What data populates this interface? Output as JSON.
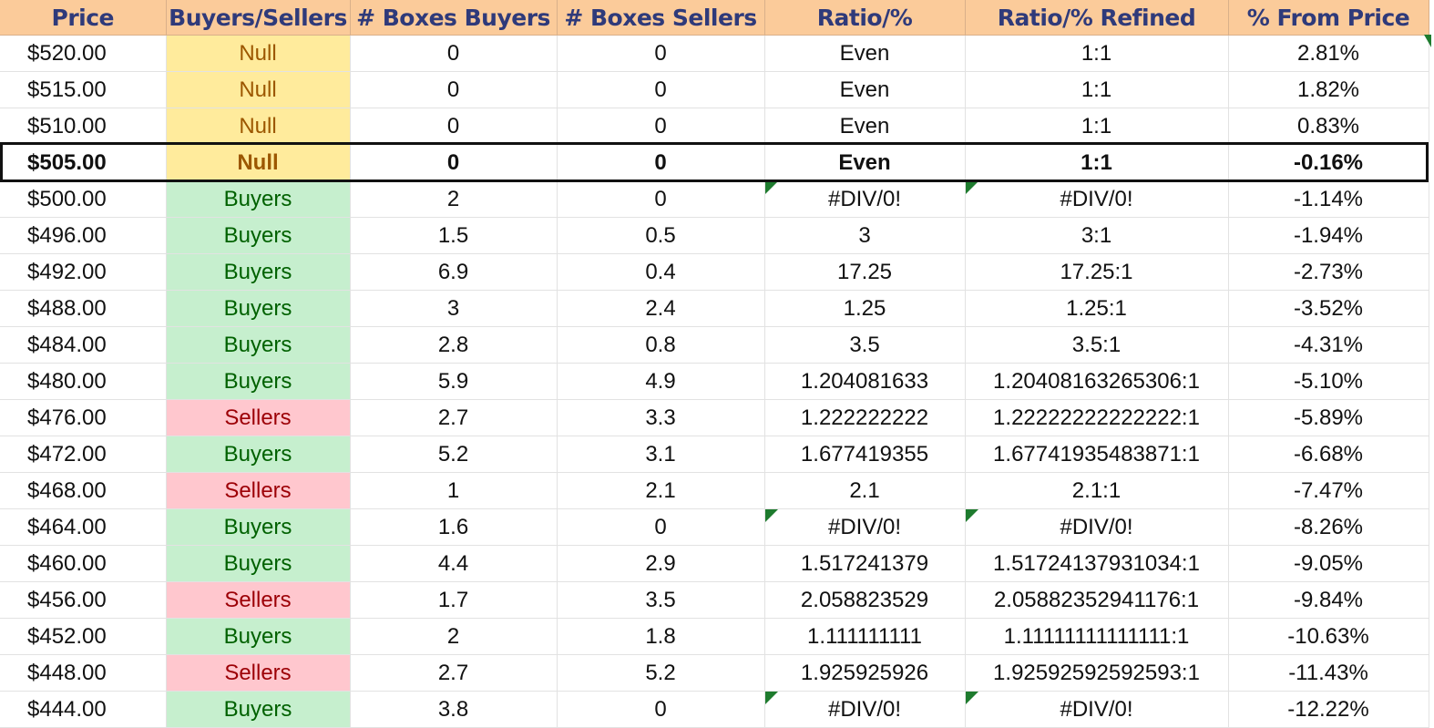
{
  "headers": [
    "Price",
    "Buyers/Sellers",
    "# Boxes Buyers",
    "# Boxes Sellers",
    "Ratio/%",
    "Ratio/% Refined",
    "% From Price"
  ],
  "colors": {
    "header_bg": "#fbcb9a",
    "header_text": "#2f3a7a",
    "null_bg": "#ffeb9c",
    "null_text": "#9c5700",
    "buyers_bg": "#c6efce",
    "buyers_text": "#006100",
    "sellers_bg": "#ffc7ce",
    "sellers_text": "#9c0006",
    "error_flag": "#1e7b2e"
  },
  "rows": [
    {
      "price": "$520.00",
      "side": "Null",
      "boxes_buyers": "0",
      "boxes_sellers": "0",
      "ratio": "Even",
      "ratio_refined": "1:1",
      "pct_from_price": "2.81%"
    },
    {
      "price": "$515.00",
      "side": "Null",
      "boxes_buyers": "0",
      "boxes_sellers": "0",
      "ratio": "Even",
      "ratio_refined": "1:1",
      "pct_from_price": "1.82%"
    },
    {
      "price": "$510.00",
      "side": "Null",
      "boxes_buyers": "0",
      "boxes_sellers": "0",
      "ratio": "Even",
      "ratio_refined": "1:1",
      "pct_from_price": "0.83%"
    },
    {
      "price": "$505.00",
      "side": "Null",
      "boxes_buyers": "0",
      "boxes_sellers": "0",
      "ratio": "Even",
      "ratio_refined": "1:1",
      "pct_from_price": "-0.16%"
    },
    {
      "price": "$500.00",
      "side": "Buyers",
      "boxes_buyers": "2",
      "boxes_sellers": "0",
      "ratio": "#DIV/0!",
      "ratio_refined": "#DIV/0!",
      "pct_from_price": "-1.14%"
    },
    {
      "price": "$496.00",
      "side": "Buyers",
      "boxes_buyers": "1.5",
      "boxes_sellers": "0.5",
      "ratio": "3",
      "ratio_refined": "3:1",
      "pct_from_price": "-1.94%"
    },
    {
      "price": "$492.00",
      "side": "Buyers",
      "boxes_buyers": "6.9",
      "boxes_sellers": "0.4",
      "ratio": "17.25",
      "ratio_refined": "17.25:1",
      "pct_from_price": "-2.73%"
    },
    {
      "price": "$488.00",
      "side": "Buyers",
      "boxes_buyers": "3",
      "boxes_sellers": "2.4",
      "ratio": "1.25",
      "ratio_refined": "1.25:1",
      "pct_from_price": "-3.52%"
    },
    {
      "price": "$484.00",
      "side": "Buyers",
      "boxes_buyers": "2.8",
      "boxes_sellers": "0.8",
      "ratio": "3.5",
      "ratio_refined": "3.5:1",
      "pct_from_price": "-4.31%"
    },
    {
      "price": "$480.00",
      "side": "Buyers",
      "boxes_buyers": "5.9",
      "boxes_sellers": "4.9",
      "ratio": "1.204081633",
      "ratio_refined": "1.20408163265306:1",
      "pct_from_price": "-5.10%"
    },
    {
      "price": "$476.00",
      "side": "Sellers",
      "boxes_buyers": "2.7",
      "boxes_sellers": "3.3",
      "ratio": "1.222222222",
      "ratio_refined": "1.22222222222222:1",
      "pct_from_price": "-5.89%"
    },
    {
      "price": "$472.00",
      "side": "Buyers",
      "boxes_buyers": "5.2",
      "boxes_sellers": "3.1",
      "ratio": "1.677419355",
      "ratio_refined": "1.67741935483871:1",
      "pct_from_price": "-6.68%"
    },
    {
      "price": "$468.00",
      "side": "Sellers",
      "boxes_buyers": "1",
      "boxes_sellers": "2.1",
      "ratio": "2.1",
      "ratio_refined": "2.1:1",
      "pct_from_price": "-7.47%"
    },
    {
      "price": "$464.00",
      "side": "Buyers",
      "boxes_buyers": "1.6",
      "boxes_sellers": "0",
      "ratio": "#DIV/0!",
      "ratio_refined": "#DIV/0!",
      "pct_from_price": "-8.26%"
    },
    {
      "price": "$460.00",
      "side": "Buyers",
      "boxes_buyers": "4.4",
      "boxes_sellers": "2.9",
      "ratio": "1.517241379",
      "ratio_refined": "1.51724137931034:1",
      "pct_from_price": "-9.05%"
    },
    {
      "price": "$456.00",
      "side": "Sellers",
      "boxes_buyers": "1.7",
      "boxes_sellers": "3.5",
      "ratio": "2.058823529",
      "ratio_refined": "2.05882352941176:1",
      "pct_from_price": "-9.84%"
    },
    {
      "price": "$452.00",
      "side": "Buyers",
      "boxes_buyers": "2",
      "boxes_sellers": "1.8",
      "ratio": "1.111111111",
      "ratio_refined": "1.11111111111111:1",
      "pct_from_price": "-10.63%"
    },
    {
      "price": "$448.00",
      "side": "Sellers",
      "boxes_buyers": "2.7",
      "boxes_sellers": "5.2",
      "ratio": "1.925925926",
      "ratio_refined": "1.92592592592593:1",
      "pct_from_price": "-11.43%"
    },
    {
      "price": "$444.00",
      "side": "Buyers",
      "boxes_buyers": "3.8",
      "boxes_sellers": "0",
      "ratio": "#DIV/0!",
      "ratio_refined": "#DIV/0!",
      "pct_from_price": "-12.22%"
    }
  ]
}
